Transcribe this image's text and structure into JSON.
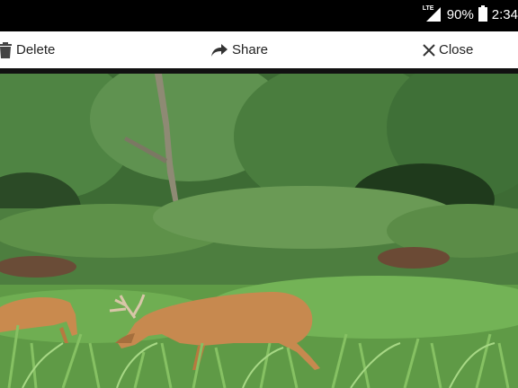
{
  "status_bar": {
    "network": "LTE",
    "battery_percent": "90%",
    "time": "2:34"
  },
  "action_bar": {
    "delete_label": "Delete",
    "share_label": "Share",
    "close_label": "Close"
  },
  "colors": {
    "status_bar_bg": "#000000",
    "action_bar_bg": "#ffffff",
    "text": "#222222"
  },
  "icons": {
    "delete": "trash-icon",
    "share": "share-arrow-icon",
    "close": "close-x-icon"
  }
}
